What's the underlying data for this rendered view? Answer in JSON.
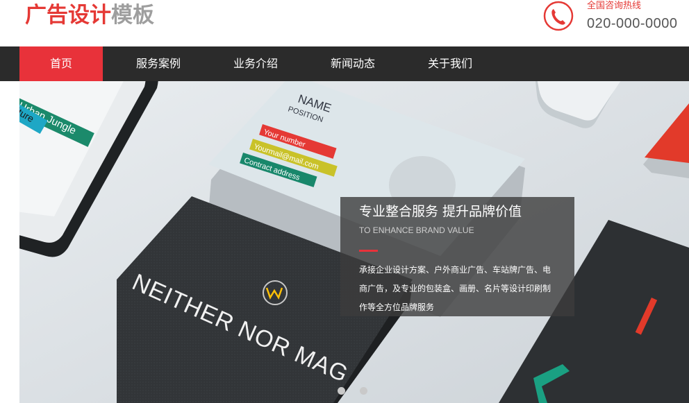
{
  "logo": {
    "red_text": "广告设计",
    "gray_text": "模板"
  },
  "hotline": {
    "label": "全国咨询热线",
    "number": "020-000-0000",
    "icon": "phone-icon"
  },
  "nav": {
    "items": [
      {
        "label": "首页",
        "active": true
      },
      {
        "label": "服务案例",
        "active": false
      },
      {
        "label": "业务介绍",
        "active": false
      },
      {
        "label": "新闻动态",
        "active": false
      },
      {
        "label": "关于我们",
        "active": false
      }
    ]
  },
  "banner": {
    "title": "专业整合服务  提升品牌价值",
    "subtitle": "TO ENHANCE BRAND VALUE",
    "description": "承接企业设计方案、户外商业广告、车站牌广告、电商广告，及专业的包装盒、画册、名片等设计印刷制作等全方位品牌服务",
    "card_texts": {
      "name": "NAME",
      "position": "POSITION",
      "field1": "Your number",
      "field2": "Yourmail@mail.com",
      "field3": "Contract address",
      "brand": "NEITHER NOR MAG",
      "tag1": "Urban Jungle",
      "tag2": "Culture"
    },
    "slide_count": 2,
    "active_slide": 0
  },
  "colors": {
    "accent": "#e8323a",
    "nav_bg": "#2b2b2b",
    "logo_gray": "#9e9e9e"
  }
}
